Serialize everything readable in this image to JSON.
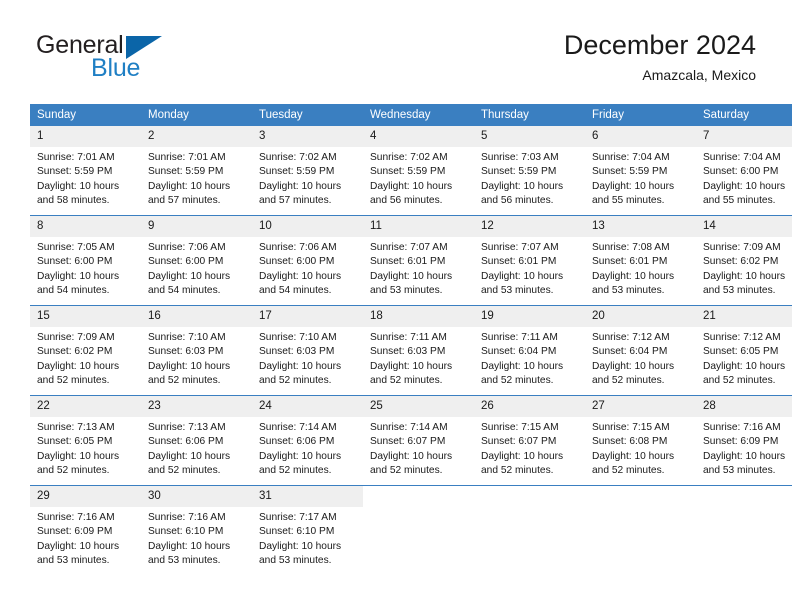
{
  "brand": {
    "name_part1": "General",
    "name_part2": "Blue",
    "flag_icon": "triangle-flag-icon"
  },
  "header": {
    "title": "December 2024",
    "subtitle": "Amazcala, Mexico"
  },
  "colors": {
    "header_bar": "#3a7fc1",
    "daynum_strip": "#efefef",
    "brand_blue": "#1f7fc4",
    "flag_blue": "#0b65a8",
    "text": "#1a1a1a"
  },
  "weekday_headers": [
    "Sunday",
    "Monday",
    "Tuesday",
    "Wednesday",
    "Thursday",
    "Friday",
    "Saturday"
  ],
  "weeks": [
    [
      {
        "day": "1",
        "sunrise": "Sunrise: 7:01 AM",
        "sunset": "Sunset: 5:59 PM",
        "daylight": "Daylight: 10 hours and 58 minutes."
      },
      {
        "day": "2",
        "sunrise": "Sunrise: 7:01 AM",
        "sunset": "Sunset: 5:59 PM",
        "daylight": "Daylight: 10 hours and 57 minutes."
      },
      {
        "day": "3",
        "sunrise": "Sunrise: 7:02 AM",
        "sunset": "Sunset: 5:59 PM",
        "daylight": "Daylight: 10 hours and 57 minutes."
      },
      {
        "day": "4",
        "sunrise": "Sunrise: 7:02 AM",
        "sunset": "Sunset: 5:59 PM",
        "daylight": "Daylight: 10 hours and 56 minutes."
      },
      {
        "day": "5",
        "sunrise": "Sunrise: 7:03 AM",
        "sunset": "Sunset: 5:59 PM",
        "daylight": "Daylight: 10 hours and 56 minutes."
      },
      {
        "day": "6",
        "sunrise": "Sunrise: 7:04 AM",
        "sunset": "Sunset: 5:59 PM",
        "daylight": "Daylight: 10 hours and 55 minutes."
      },
      {
        "day": "7",
        "sunrise": "Sunrise: 7:04 AM",
        "sunset": "Sunset: 6:00 PM",
        "daylight": "Daylight: 10 hours and 55 minutes."
      }
    ],
    [
      {
        "day": "8",
        "sunrise": "Sunrise: 7:05 AM",
        "sunset": "Sunset: 6:00 PM",
        "daylight": "Daylight: 10 hours and 54 minutes."
      },
      {
        "day": "9",
        "sunrise": "Sunrise: 7:06 AM",
        "sunset": "Sunset: 6:00 PM",
        "daylight": "Daylight: 10 hours and 54 minutes."
      },
      {
        "day": "10",
        "sunrise": "Sunrise: 7:06 AM",
        "sunset": "Sunset: 6:00 PM",
        "daylight": "Daylight: 10 hours and 54 minutes."
      },
      {
        "day": "11",
        "sunrise": "Sunrise: 7:07 AM",
        "sunset": "Sunset: 6:01 PM",
        "daylight": "Daylight: 10 hours and 53 minutes."
      },
      {
        "day": "12",
        "sunrise": "Sunrise: 7:07 AM",
        "sunset": "Sunset: 6:01 PM",
        "daylight": "Daylight: 10 hours and 53 minutes."
      },
      {
        "day": "13",
        "sunrise": "Sunrise: 7:08 AM",
        "sunset": "Sunset: 6:01 PM",
        "daylight": "Daylight: 10 hours and 53 minutes."
      },
      {
        "day": "14",
        "sunrise": "Sunrise: 7:09 AM",
        "sunset": "Sunset: 6:02 PM",
        "daylight": "Daylight: 10 hours and 53 minutes."
      }
    ],
    [
      {
        "day": "15",
        "sunrise": "Sunrise: 7:09 AM",
        "sunset": "Sunset: 6:02 PM",
        "daylight": "Daylight: 10 hours and 52 minutes."
      },
      {
        "day": "16",
        "sunrise": "Sunrise: 7:10 AM",
        "sunset": "Sunset: 6:03 PM",
        "daylight": "Daylight: 10 hours and 52 minutes."
      },
      {
        "day": "17",
        "sunrise": "Sunrise: 7:10 AM",
        "sunset": "Sunset: 6:03 PM",
        "daylight": "Daylight: 10 hours and 52 minutes."
      },
      {
        "day": "18",
        "sunrise": "Sunrise: 7:11 AM",
        "sunset": "Sunset: 6:03 PM",
        "daylight": "Daylight: 10 hours and 52 minutes."
      },
      {
        "day": "19",
        "sunrise": "Sunrise: 7:11 AM",
        "sunset": "Sunset: 6:04 PM",
        "daylight": "Daylight: 10 hours and 52 minutes."
      },
      {
        "day": "20",
        "sunrise": "Sunrise: 7:12 AM",
        "sunset": "Sunset: 6:04 PM",
        "daylight": "Daylight: 10 hours and 52 minutes."
      },
      {
        "day": "21",
        "sunrise": "Sunrise: 7:12 AM",
        "sunset": "Sunset: 6:05 PM",
        "daylight": "Daylight: 10 hours and 52 minutes."
      }
    ],
    [
      {
        "day": "22",
        "sunrise": "Sunrise: 7:13 AM",
        "sunset": "Sunset: 6:05 PM",
        "daylight": "Daylight: 10 hours and 52 minutes."
      },
      {
        "day": "23",
        "sunrise": "Sunrise: 7:13 AM",
        "sunset": "Sunset: 6:06 PM",
        "daylight": "Daylight: 10 hours and 52 minutes."
      },
      {
        "day": "24",
        "sunrise": "Sunrise: 7:14 AM",
        "sunset": "Sunset: 6:06 PM",
        "daylight": "Daylight: 10 hours and 52 minutes."
      },
      {
        "day": "25",
        "sunrise": "Sunrise: 7:14 AM",
        "sunset": "Sunset: 6:07 PM",
        "daylight": "Daylight: 10 hours and 52 minutes."
      },
      {
        "day": "26",
        "sunrise": "Sunrise: 7:15 AM",
        "sunset": "Sunset: 6:07 PM",
        "daylight": "Daylight: 10 hours and 52 minutes."
      },
      {
        "day": "27",
        "sunrise": "Sunrise: 7:15 AM",
        "sunset": "Sunset: 6:08 PM",
        "daylight": "Daylight: 10 hours and 52 minutes."
      },
      {
        "day": "28",
        "sunrise": "Sunrise: 7:16 AM",
        "sunset": "Sunset: 6:09 PM",
        "daylight": "Daylight: 10 hours and 53 minutes."
      }
    ],
    [
      {
        "day": "29",
        "sunrise": "Sunrise: 7:16 AM",
        "sunset": "Sunset: 6:09 PM",
        "daylight": "Daylight: 10 hours and 53 minutes."
      },
      {
        "day": "30",
        "sunrise": "Sunrise: 7:16 AM",
        "sunset": "Sunset: 6:10 PM",
        "daylight": "Daylight: 10 hours and 53 minutes."
      },
      {
        "day": "31",
        "sunrise": "Sunrise: 7:17 AM",
        "sunset": "Sunset: 6:10 PM",
        "daylight": "Daylight: 10 hours and 53 minutes."
      },
      {
        "day": "",
        "sunrise": "",
        "sunset": "",
        "daylight": ""
      },
      {
        "day": "",
        "sunrise": "",
        "sunset": "",
        "daylight": ""
      },
      {
        "day": "",
        "sunrise": "",
        "sunset": "",
        "daylight": ""
      },
      {
        "day": "",
        "sunrise": "",
        "sunset": "",
        "daylight": ""
      }
    ]
  ]
}
